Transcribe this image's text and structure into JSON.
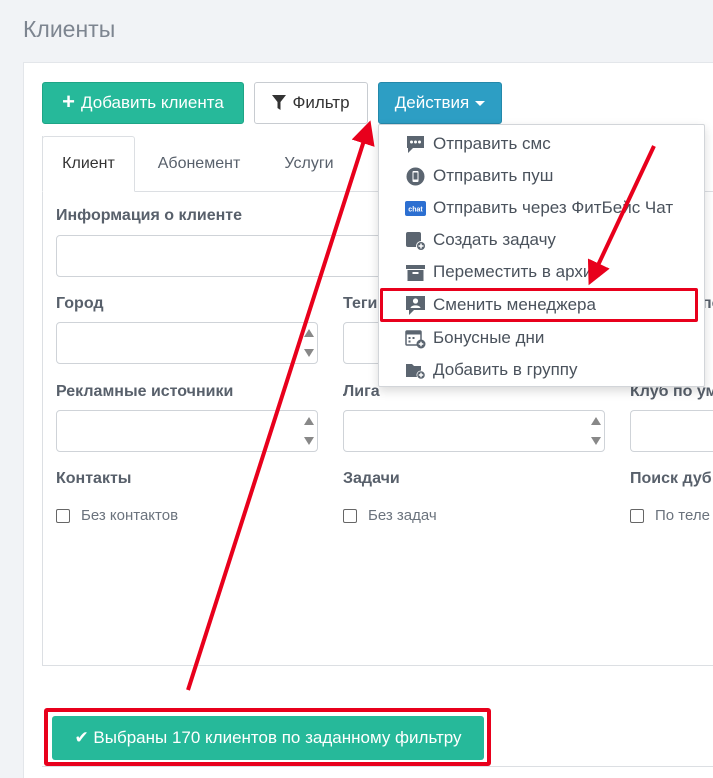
{
  "page": {
    "title": "Клиенты"
  },
  "toolbar": {
    "add_label": "Добавить клиента",
    "filter_label": "Фильтр",
    "actions_label": "Действия"
  },
  "tabs": [
    "Клиент",
    "Абонемент",
    "Услуги"
  ],
  "form": {
    "info_label": "Информация о клиенте",
    "city_label": "Город",
    "tags_label": "Теги",
    "col3_label_partial": "по",
    "ads_label": "Рекламные источники",
    "league_label": "Лига",
    "club_label": "Клуб по ум",
    "contacts_label": "Контакты",
    "tasks_label": "Задачи",
    "dupes_label": "Поиск дуб",
    "no_contacts": "Без контактов",
    "no_tasks": "Без задач",
    "by_phone": "По теле"
  },
  "dropdown": {
    "items": [
      {
        "label": "Отправить смс",
        "icon": "sms-icon"
      },
      {
        "label": "Отправить пуш",
        "icon": "push-icon"
      },
      {
        "label": "Отправить через ФитБейс Чат",
        "icon": "chat-icon",
        "badge": "chat"
      },
      {
        "label": "Создать задачу",
        "icon": "create-task-icon"
      },
      {
        "label": "Переместить в архив",
        "icon": "archive-icon"
      },
      {
        "label": "Сменить менеджера",
        "icon": "change-manager-icon"
      },
      {
        "label": "Бонусные дни",
        "icon": "bonus-days-icon"
      },
      {
        "label": "Добавить в группу",
        "icon": "add-group-icon"
      }
    ]
  },
  "selection": {
    "label": "✔ Выбраны 170 клиентов по заданному фильтру"
  },
  "colors": {
    "green": "#26b99a",
    "blue": "#2d9ec4",
    "highlight": "#e8001c",
    "icon": "#5b6570"
  }
}
